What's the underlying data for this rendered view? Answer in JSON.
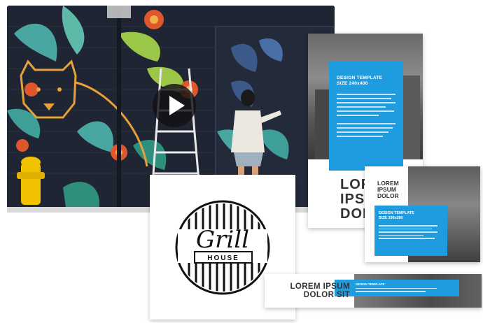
{
  "video": {
    "play_icon": "play-icon",
    "colors": {
      "wall": "#1f2533",
      "play_button": "#121212"
    }
  },
  "flyer_tall": {
    "template_title": "DESIGN TEMPLATE",
    "template_size": "SIZE 240x400",
    "headline": [
      "LOREM",
      "IPSUM",
      "DOLOR"
    ],
    "accent": "#1f9ce0"
  },
  "flyer_small": {
    "headline": [
      "LOREM",
      "IPSUM",
      "DOLOR"
    ],
    "template_title": "DESIGN TEMPLATE",
    "template_size": "SIZE 336x280"
  },
  "logo": {
    "name_script": "Grill",
    "name_caps": "HOUSE"
  },
  "banner": {
    "line1": "LOREM IPSUM",
    "line2": "DOLOR SIT",
    "template_title": "DESIGN TEMPLATE"
  }
}
